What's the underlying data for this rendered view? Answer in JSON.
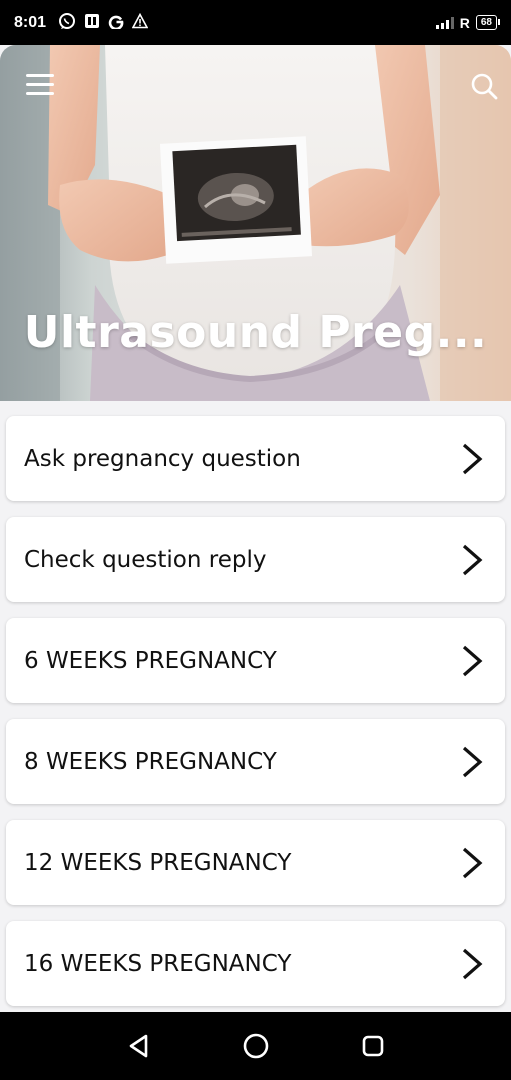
{
  "status_bar": {
    "time": "8:01",
    "left_icons": [
      "whatsapp-icon",
      "document-icon",
      "google-icon",
      "warning-icon"
    ],
    "network_label": "R",
    "battery": "68"
  },
  "header": {
    "title": "Ultrasound Preg...",
    "menu_icon": "hamburger-menu-icon",
    "search_icon": "search-icon"
  },
  "list": {
    "items": [
      {
        "label": "Ask pregnancy question"
      },
      {
        "label": "Check question reply"
      },
      {
        "label": "6 WEEKS PREGNANCY"
      },
      {
        "label": "8 WEEKS PREGNANCY"
      },
      {
        "label": "12 WEEKS PREGNANCY"
      },
      {
        "label": "16 WEEKS PREGNANCY"
      }
    ],
    "item_icon": "chevron-right-icon"
  },
  "nav_bar": {
    "buttons": [
      "back-icon",
      "home-icon",
      "recents-icon"
    ]
  },
  "colors": {
    "status_bar_bg": "#000000",
    "card_bg": "#ffffff",
    "page_bg": "#f3f3f5",
    "text": "#111111"
  }
}
